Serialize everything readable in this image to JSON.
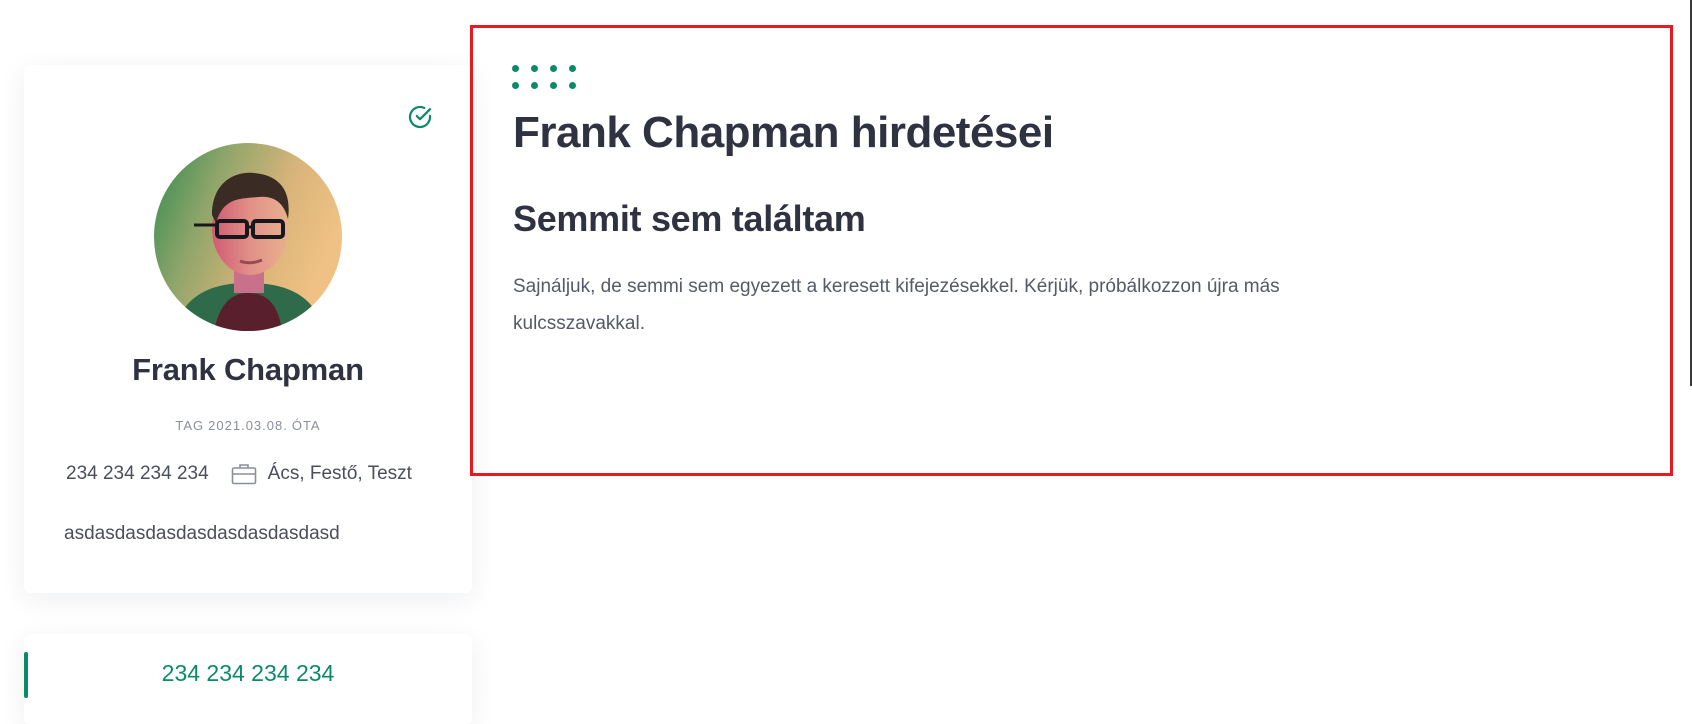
{
  "profile": {
    "name": "Frank Chapman",
    "member_since_prefix": "TAG",
    "member_since_date": "2021.03.08.",
    "member_since_suffix": "ÓTA",
    "phone": "234 234 234 234",
    "professions": "Ács, Festő, Teszt",
    "bio": "asdasdasdasdasdasdasdasdasd",
    "verified_icon": "check-circle-icon",
    "profession_icon": "briefcase-icon"
  },
  "contact_card": {
    "phone": "234 234 234 234"
  },
  "listings": {
    "title": "Frank Chapman hirdetései",
    "empty_title": "Semmit sem találtam",
    "empty_message": "Sajnáljuk, de semmi sem egyezett a keresett kifejezésekkel. Kérjük, próbálkozzon újra más kulcsszavakkal."
  },
  "colors": {
    "accent": "#0b8a6a",
    "heading": "#2f3341",
    "text": "#555a66",
    "highlight_border": "#e8191f"
  }
}
